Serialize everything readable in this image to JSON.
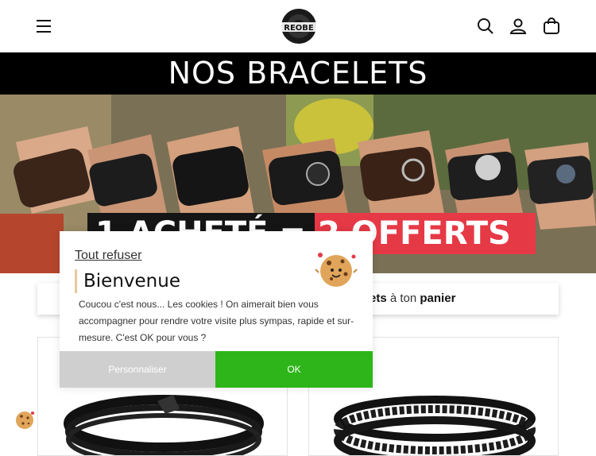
{
  "header": {
    "logo_text": "REOBE",
    "menu_icon": "hamburger-menu-icon",
    "search_icon": "search-icon",
    "account_icon": "user-icon",
    "cart_icon": "cart-icon"
  },
  "banner": {
    "title": "NOS BRACELETS"
  },
  "hero": {
    "promo_left": "1 ACHETÉ =",
    "promo_right": "2 OFFERTS"
  },
  "info_bar": {
    "bold1": "ets",
    "mid": " à ton ",
    "bold2": "panier"
  },
  "cookie_modal": {
    "refuse_label": "Tout refuser",
    "title": "Bienvenue",
    "text": "Coucou c'est nous... Les cookies ! On aimerait bien vous accompagner pour rendre votre visite plus sympas, rapide et sur-mesure. C'est OK pour vous ?",
    "customize_label": "Personnaliser",
    "ok_label": "OK"
  },
  "colors": {
    "banner_bg": "#000000",
    "promo_red": "#e63946",
    "ok_green": "#2eb51a",
    "customize_grey": "#cfcfcf"
  }
}
